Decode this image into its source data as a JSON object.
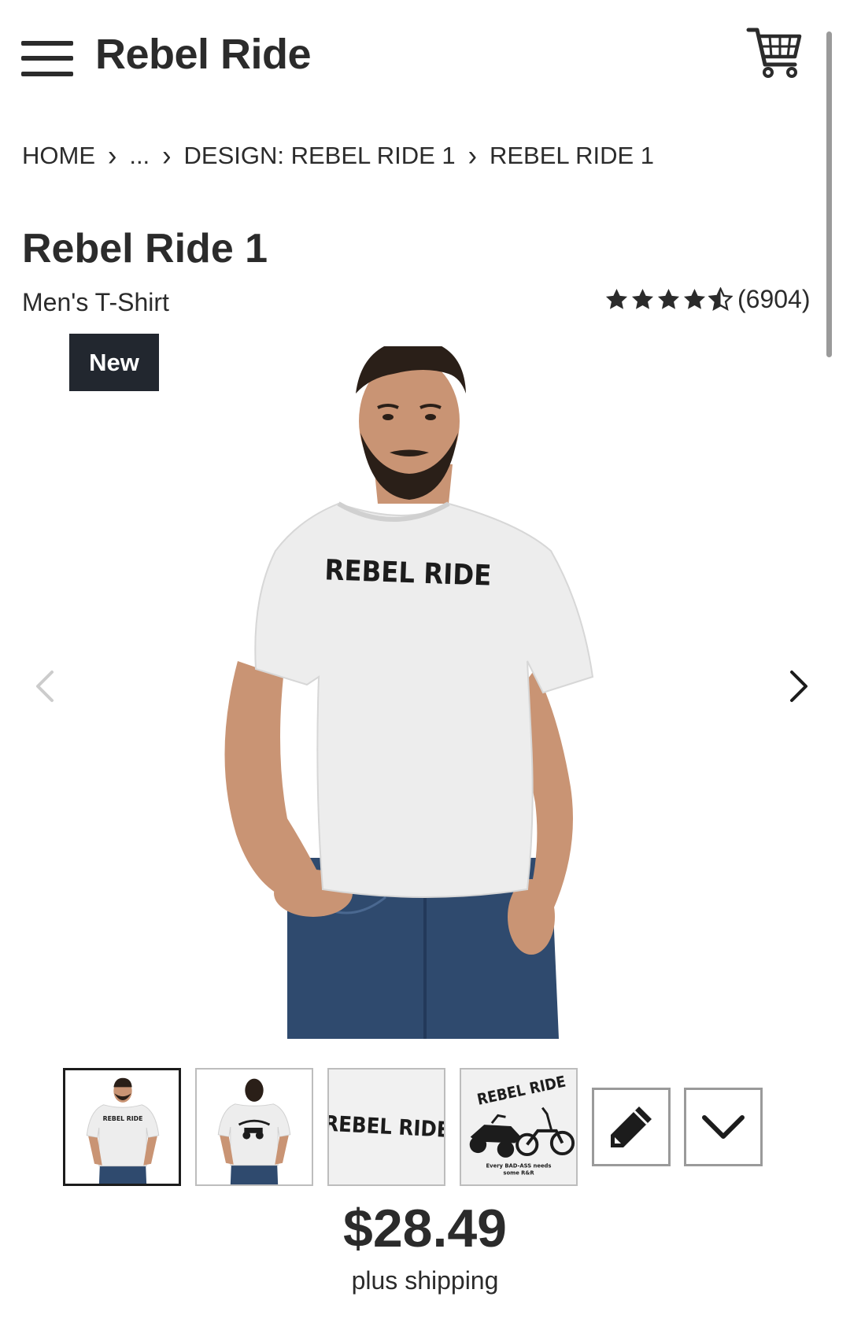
{
  "header": {
    "brand": "Rebel Ride",
    "menu_icon": "hamburger-menu-icon",
    "cart_icon": "shopping-cart-icon"
  },
  "breadcrumb": {
    "items": [
      "HOME",
      "...",
      "DESIGN: REBEL RIDE 1",
      "REBEL RIDE 1"
    ],
    "separator_icon": "chevron-right-icon"
  },
  "product": {
    "title": "Rebel Ride 1",
    "type": "Men's T-Shirt",
    "badge": "New",
    "rating_stars": 4.5,
    "rating_count": "(6904)",
    "shirt_print": "REBEL RIDE"
  },
  "gallery": {
    "prev_icon": "chevron-left-icon",
    "next_icon": "chevron-right-icon",
    "thumbnails": [
      {
        "name": "front-view"
      },
      {
        "name": "back-view"
      },
      {
        "name": "design-front-closeup",
        "text": "REBEL RIDE"
      },
      {
        "name": "design-back-closeup",
        "text": "REBEL RIDE",
        "caption_1": "Every BAD-ASS needs",
        "caption_2": "some R&R"
      }
    ],
    "edit_icon": "pencil-icon",
    "more_icon": "chevron-down-icon"
  },
  "pricing": {
    "price": "$28.49",
    "shipping": "plus shipping"
  },
  "colors": {
    "text": "#2b2b2b",
    "badge_bg": "#22272f",
    "shirt": "#ededed",
    "jeans": "#2f4a6e",
    "skin": "#c99474",
    "hair": "#2a1f18"
  }
}
